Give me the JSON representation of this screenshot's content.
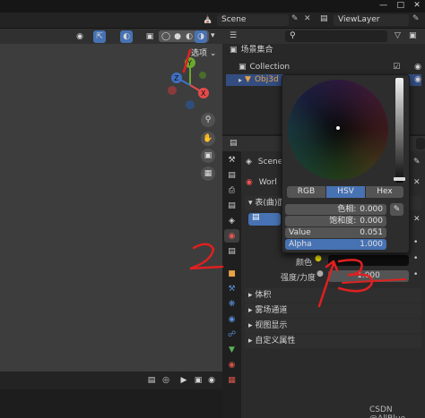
{
  "colors": {
    "accent_blue": "#4772b3",
    "annotation_red": "#e02020",
    "axis_x": "#e44b4b",
    "axis_y": "#6ba82e",
    "axis_z": "#3f70c4"
  },
  "scene_bar": {
    "scene_name": "Scene",
    "view_layer": "ViewLayer"
  },
  "viewport": {
    "options_label": "选项",
    "gizmo": {
      "x": "X",
      "y": "Y",
      "z": "Z"
    }
  },
  "outliner": {
    "root": "场景集合",
    "items": [
      {
        "label": "Collection"
      },
      {
        "label": "Obj3d"
      }
    ]
  },
  "properties": {
    "scene_label": "Scene",
    "world_label": "Worl",
    "surface_label": "表(曲)面",
    "color_label": "颜色",
    "strength_label": "强度/力度",
    "strength_value": "1.000",
    "sections": [
      "体积",
      "雾场通道",
      "视图显示",
      "自定义属性"
    ]
  },
  "color_picker": {
    "modes": [
      "RGB",
      "HSV",
      "Hex"
    ],
    "active_mode": "HSV",
    "fields": [
      {
        "label": "色相:",
        "value": "0.000"
      },
      {
        "label": "饱和度:",
        "value": "0.000"
      },
      {
        "label": "Value",
        "value": "0.051"
      },
      {
        "label": "Alpha",
        "value": "1.000"
      }
    ]
  },
  "annotations": {
    "numbers": [
      "1",
      "2",
      "3"
    ]
  },
  "watermark": "CSDN @AllBlue"
}
